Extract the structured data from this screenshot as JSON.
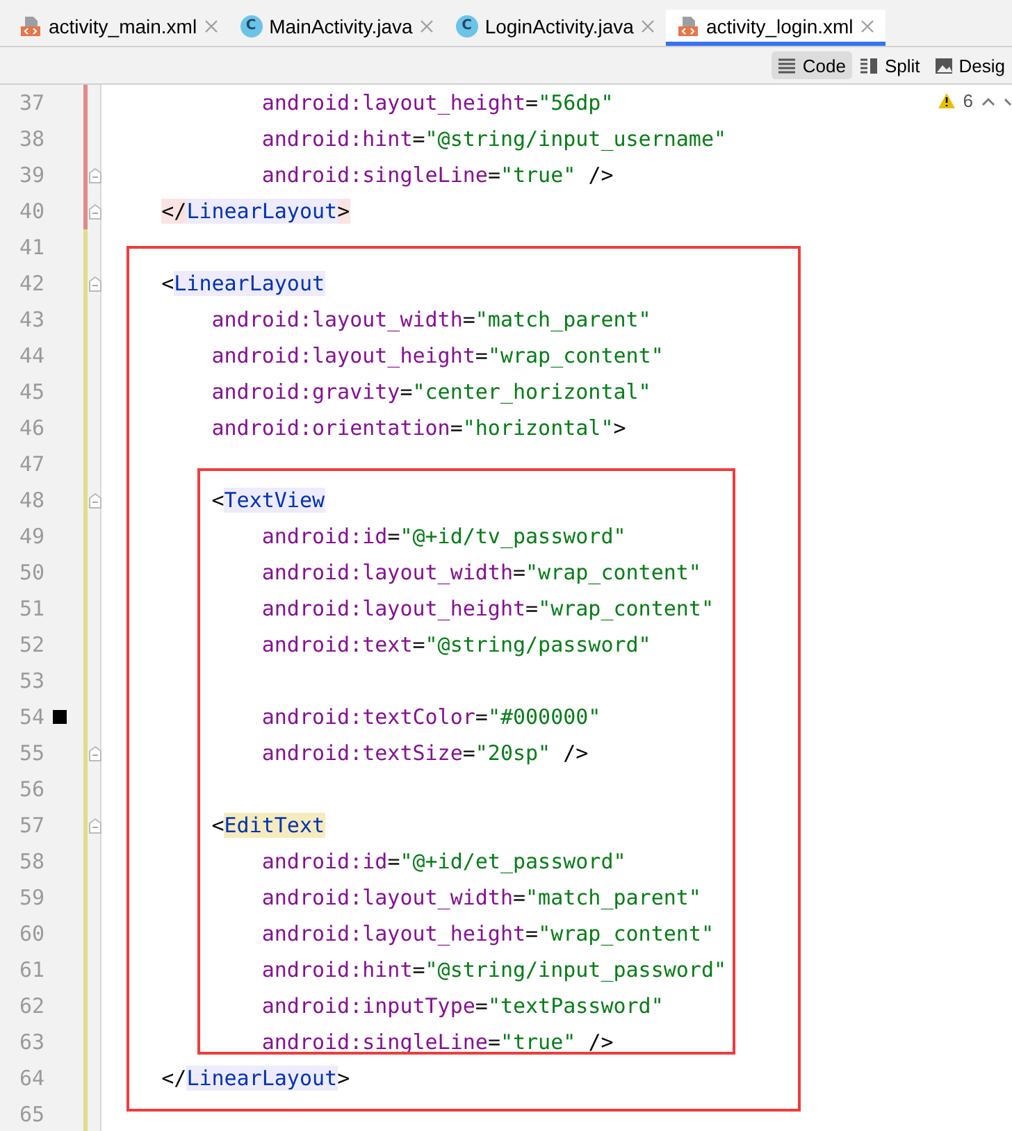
{
  "tabs": [
    {
      "label": "activity_main.xml",
      "kind": "xml",
      "selected": false
    },
    {
      "label": "MainActivity.java",
      "kind": "class",
      "icon_text": "C",
      "selected": false
    },
    {
      "label": "LoginActivity.java",
      "kind": "class",
      "icon_text": "C",
      "selected": false
    },
    {
      "label": "activity_login.xml",
      "kind": "xml",
      "selected": true
    }
  ],
  "view_modes": [
    {
      "label": "Code",
      "kind": "code",
      "selected": true
    },
    {
      "label": "Split",
      "kind": "split",
      "selected": false
    },
    {
      "label": "Desig",
      "kind": "design",
      "selected": false
    }
  ],
  "inspections": {
    "warnings": "6"
  },
  "blocks": [
    {
      "kind": "plain",
      "lines": [
        {
          "number": "37",
          "color": "#e08a8a",
          "fold": false,
          "breakpoint": false,
          "code": [
            {
              "kind": "attr",
              "text": "            android:layout_height"
            },
            {
              "kind": "text",
              "text": "="
            },
            {
              "kind": "value",
              "text": "\"56dp\""
            }
          ]
        },
        {
          "number": "38",
          "color": "#e08a8a",
          "fold": false,
          "breakpoint": false,
          "code": [
            {
              "kind": "attr",
              "text": "            android:hint"
            },
            {
              "kind": "text",
              "text": "="
            },
            {
              "kind": "value",
              "text": "\"@string/input_username\""
            }
          ]
        },
        {
          "number": "39",
          "color": "#e08a8a",
          "fold": true,
          "breakpoint": false,
          "code": [
            {
              "kind": "attr",
              "text": "            android:singleLine"
            },
            {
              "kind": "text",
              "text": "="
            },
            {
              "kind": "value",
              "text": "\"true\""
            },
            {
              "kind": "text",
              "text": " />"
            }
          ]
        },
        {
          "number": "40",
          "color": "#e08a8a",
          "fold": true,
          "breakpoint": false,
          "code": [
            {
              "kind": "match",
              "text": "    </"
            },
            {
              "kind": "tag",
              "text": "LinearLayout"
            },
            {
              "kind": "match",
              "text": ">"
            }
          ]
        }
      ]
    },
    {
      "kind": "boxed",
      "lines": [
        {
          "number": "41",
          "color": "#e1dc8c",
          "fold": false,
          "breakpoint": false
        },
        {
          "number": "42",
          "color": "#e1dc8c",
          "fold": true,
          "breakpoint": false,
          "code": [
            {
              "kind": "text",
              "text": "    <"
            },
            {
              "kind": "tag",
              "text": "LinearLayout"
            }
          ]
        },
        {
          "number": "43",
          "color": "#e1dc8c",
          "fold": false,
          "breakpoint": false,
          "code": [
            {
              "kind": "attr",
              "text": "        android:layout_width"
            },
            {
              "kind": "text",
              "text": "="
            },
            {
              "kind": "value",
              "text": "\"match_parent\""
            }
          ]
        },
        {
          "number": "44",
          "color": "#e1dc8c",
          "fold": false,
          "breakpoint": false,
          "code": [
            {
              "kind": "attr",
              "text": "        android:layout_height"
            },
            {
              "kind": "text",
              "text": "="
            },
            {
              "kind": "value",
              "text": "\"wrap_content\""
            }
          ]
        },
        {
          "number": "45",
          "color": "#e1dc8c",
          "fold": false,
          "breakpoint": false,
          "code": [
            {
              "kind": "attr",
              "text": "        android:gravity"
            },
            {
              "kind": "text",
              "text": "="
            },
            {
              "kind": "value",
              "text": "\"center_horizontal\""
            }
          ]
        },
        {
          "number": "46",
          "color": "#e1dc8c",
          "fold": false,
          "breakpoint": false,
          "code": [
            {
              "kind": "attr",
              "text": "        android:orientation"
            },
            {
              "kind": "text",
              "text": "="
            },
            {
              "kind": "value",
              "text": "\"horizontal\""
            },
            {
              "kind": "text",
              "text": ">"
            }
          ]
        },
        {
          "kind": "boxed",
          "lines": [
            {
              "number": "47",
              "color": "#e1dc8c",
              "fold": false,
              "breakpoint": false
            },
            {
              "number": "48",
              "color": "#e1dc8c",
              "fold": true,
              "breakpoint": false,
              "code": [
                {
                  "kind": "text",
                  "text": "        <"
                },
                {
                  "kind": "tag",
                  "text": "TextView"
                }
              ]
            },
            {
              "number": "49",
              "color": "#e1dc8c",
              "fold": false,
              "breakpoint": false,
              "code": [
                {
                  "kind": "attr",
                  "text": "            android:id"
                },
                {
                  "kind": "text",
                  "text": "="
                },
                {
                  "kind": "value",
                  "text": "\"@+id/tv_password\""
                }
              ]
            },
            {
              "number": "50",
              "color": "#e1dc8c",
              "fold": false,
              "breakpoint": false,
              "code": [
                {
                  "kind": "attr",
                  "text": "            android:layout_width"
                },
                {
                  "kind": "text",
                  "text": "="
                },
                {
                  "kind": "value",
                  "text": "\"wrap_content\""
                }
              ]
            },
            {
              "number": "51",
              "color": "#e1dc8c",
              "fold": false,
              "breakpoint": false,
              "code": [
                {
                  "kind": "attr",
                  "text": "            android:layout_height"
                },
                {
                  "kind": "text",
                  "text": "="
                },
                {
                  "kind": "value",
                  "text": "\"wrap_content\""
                }
              ]
            },
            {
              "number": "52",
              "color": "#e1dc8c",
              "fold": false,
              "breakpoint": false,
              "code": [
                {
                  "kind": "attr",
                  "text": "            android:text"
                },
                {
                  "kind": "text",
                  "text": "="
                },
                {
                  "kind": "value",
                  "text": "\"@string/password\""
                }
              ]
            },
            {
              "number": "53",
              "color": "#e1dc8c",
              "fold": false,
              "breakpoint": false
            },
            {
              "number": "54",
              "color": "#e1dc8c",
              "fold": false,
              "breakpoint": true,
              "code": [
                {
                  "kind": "attr",
                  "text": "            android:textColor"
                },
                {
                  "kind": "text",
                  "text": "="
                },
                {
                  "kind": "value",
                  "text": "\"#000000\""
                }
              ]
            },
            {
              "number": "55",
              "color": "#e1dc8c",
              "fold": true,
              "breakpoint": false,
              "code": [
                {
                  "kind": "attr",
                  "text": "            android:textSize"
                },
                {
                  "kind": "text",
                  "text": "="
                },
                {
                  "kind": "value",
                  "text": "\"20sp\""
                },
                {
                  "kind": "text",
                  "text": " />"
                }
              ]
            },
            {
              "number": "56",
              "color": "#e1dc8c",
              "fold": false,
              "breakpoint": false
            },
            {
              "number": "57",
              "color": "#e1dc8c",
              "fold": true,
              "breakpoint": false,
              "code": [
                {
                  "kind": "text",
                  "text": "        <"
                },
                {
                  "kind": "tag-caret",
                  "text": "EditText"
                }
              ]
            },
            {
              "number": "58",
              "color": "#e1dc8c",
              "fold": false,
              "breakpoint": false,
              "code": [
                {
                  "kind": "attr",
                  "text": "            android:id"
                },
                {
                  "kind": "text",
                  "text": "="
                },
                {
                  "kind": "value",
                  "text": "\"@+id/et_password\""
                }
              ]
            },
            {
              "number": "59",
              "color": "#e1dc8c",
              "fold": false,
              "breakpoint": false,
              "code": [
                {
                  "kind": "attr",
                  "text": "            android:layout_width"
                },
                {
                  "kind": "text",
                  "text": "="
                },
                {
                  "kind": "value",
                  "text": "\"match_parent\""
                }
              ]
            },
            {
              "number": "60",
              "color": "#e1dc8c",
              "fold": false,
              "breakpoint": false,
              "code": [
                {
                  "kind": "attr",
                  "text": "            android:layout_height"
                },
                {
                  "kind": "text",
                  "text": "="
                },
                {
                  "kind": "value",
                  "text": "\"wrap_content\""
                }
              ]
            },
            {
              "number": "61",
              "color": "#e1dc8c",
              "fold": false,
              "breakpoint": false,
              "code": [
                {
                  "kind": "attr",
                  "text": "            android:hint"
                },
                {
                  "kind": "text",
                  "text": "="
                },
                {
                  "kind": "value",
                  "text": "\"@string/input_password\""
                }
              ]
            },
            {
              "number": "62",
              "color": "#e1dc8c",
              "fold": false,
              "breakpoint": false,
              "code": [
                {
                  "kind": "attr",
                  "text": "            android:inputType"
                },
                {
                  "kind": "text",
                  "text": "="
                },
                {
                  "kind": "value",
                  "text": "\"textPassword\""
                }
              ]
            },
            {
              "number": "63",
              "color": "#e1dc8c",
              "fold": false,
              "breakpoint": false,
              "code": [
                {
                  "kind": "attr",
                  "text": "            android:singleLine"
                },
                {
                  "kind": "text",
                  "text": "="
                },
                {
                  "kind": "value",
                  "text": "\"true\""
                },
                {
                  "kind": "text",
                  "text": " />"
                }
              ]
            }
          ]
        },
        {
          "number": "64",
          "color": "#e1dc8c",
          "fold": false,
          "breakpoint": false,
          "code": [
            {
              "kind": "text",
              "text": "    </"
            },
            {
              "kind": "tag",
              "text": "LinearLayout"
            },
            {
              "kind": "text",
              "text": ">"
            }
          ]
        }
      ]
    },
    {
      "kind": "plain",
      "lines": [
        {
          "number": "65",
          "color": "#e1dc8c",
          "fold": false,
          "breakpoint": false
        }
      ]
    }
  ]
}
